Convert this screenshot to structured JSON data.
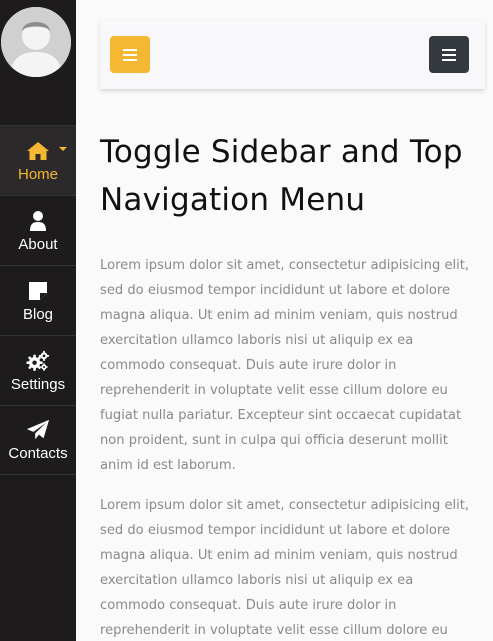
{
  "sidebar": {
    "avatar_icon": "user-avatar-placeholder",
    "items": [
      {
        "label": "Home",
        "icon": "home-icon",
        "active": true,
        "has_dropdown": true
      },
      {
        "label": "About",
        "icon": "user-icon"
      },
      {
        "label": "Blog",
        "icon": "note-icon"
      },
      {
        "label": "Settings",
        "icon": "cogs-icon"
      },
      {
        "label": "Contacts",
        "icon": "paper-plane-icon"
      }
    ]
  },
  "topbar": {
    "toggle_button_icon": "bars-icon",
    "menu_button_icon": "bars-icon"
  },
  "main": {
    "title": "Toggle Sidebar and Top Navigation Menu",
    "paragraphs": [
      "Lorem ipsum dolor sit amet, consectetur adipisicing elit, sed do eiusmod tempor incididunt ut labore et dolore magna aliqua. Ut enim ad minim veniam, quis nostrud exercitation ullamco laboris nisi ut aliquip ex ea commodo consequat. Duis aute irure dolor in reprehenderit in voluptate velit esse cillum dolore eu fugiat nulla pariatur. Excepteur sint occaecat cupidatat non proident, sunt in culpa qui officia deserunt mollit anim id est laborum.",
      "Lorem ipsum dolor sit amet, consectetur adipisicing elit, sed do eiusmod tempor incididunt ut labore et dolore magna aliqua. Ut enim ad minim veniam, quis nostrud exercitation ullamco laboris nisi ut aliquip ex ea commodo consequat. Duis aute irure dolor in reprehenderit in voluptate velit esse cillum dolore eu"
    ]
  },
  "colors": {
    "sidebar_bg": "#1d1b1b",
    "accent": "#f6b732",
    "dark_button": "#343a40",
    "text_muted": "#8a8a8a"
  }
}
